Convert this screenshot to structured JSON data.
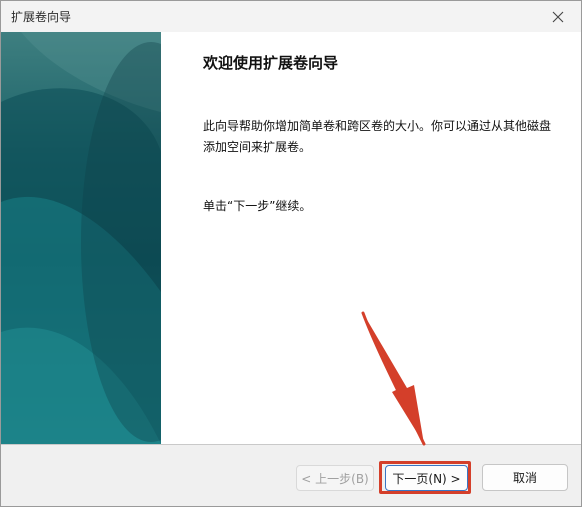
{
  "window": {
    "title": "扩展卷向导",
    "close_glyph": "close-icon"
  },
  "main": {
    "heading": "欢迎使用扩展卷向导",
    "description": "此向导帮助你增加简单卷和跨区卷的大小。你可以通过从其他磁盘添加空间来扩展卷。",
    "instruction": "单击“下一步”继续。"
  },
  "footer": {
    "back_label": "< 上一步(B)",
    "next_label": "下一页(N) >",
    "cancel_label": "取消"
  },
  "annotation": {
    "highlight_color": "#d43f2a"
  },
  "colors": {
    "side_art_dark": "#0f5760",
    "side_art_light": "#3e7f80",
    "accent_border": "#3a75c4"
  }
}
